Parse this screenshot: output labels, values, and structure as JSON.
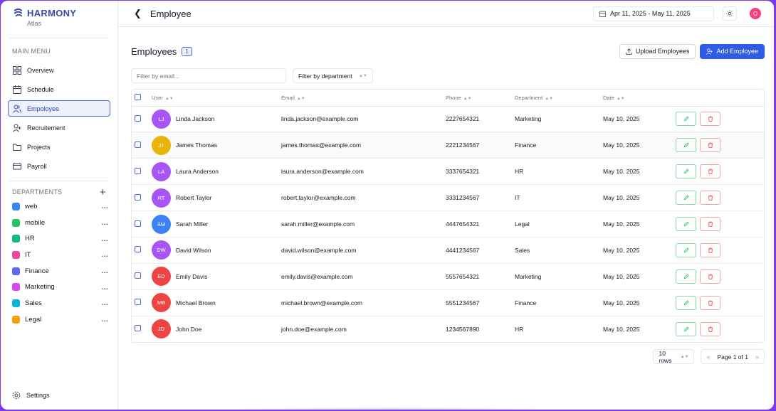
{
  "brand": {
    "name": "HARMONY",
    "sub": "Atlas"
  },
  "sidebar": {
    "main_menu_label": "MAIN MENU",
    "items": [
      {
        "label": "Overview",
        "icon": "grid-icon"
      },
      {
        "label": "Schedule",
        "icon": "calendar-icon"
      },
      {
        "label": "Empoloyee",
        "icon": "users-icon",
        "active": true
      },
      {
        "label": "Recruitement",
        "icon": "user-plus-icon"
      },
      {
        "label": "Projects",
        "icon": "folder-icon"
      },
      {
        "label": "Payroll",
        "icon": "card-icon"
      }
    ],
    "departments_label": "DEPARTMENTS",
    "departments": [
      {
        "name": "web",
        "color": "#3b82f6"
      },
      {
        "name": "mobile",
        "color": "#22c55e"
      },
      {
        "name": "HR",
        "color": "#10b981"
      },
      {
        "name": "IT",
        "color": "#ec4899"
      },
      {
        "name": "Finance",
        "color": "#6366f1"
      },
      {
        "name": "Marketing",
        "color": "#d946ef"
      },
      {
        "name": "Sales",
        "color": "#06b6d4"
      },
      {
        "name": "Legal",
        "color": "#f59e0b"
      }
    ],
    "more_label": "...",
    "settings_label": "Settings"
  },
  "topbar": {
    "title": "Employee",
    "date_range": "Apr 11, 2025 - May 11, 2025",
    "avatar_initial": "O"
  },
  "page": {
    "title": "Employees",
    "count": "1",
    "upload_label": "Upload Employees",
    "add_label": "Add Employee",
    "filter_email_placeholder": "Filter by email...",
    "filter_department_label": "Filter by department"
  },
  "table": {
    "columns": [
      "User",
      "Email",
      "Phone",
      "Department",
      "Date"
    ],
    "rows": [
      {
        "initials": "LJ",
        "color": "#a855f7",
        "name": "Linda Jackson",
        "email": "linda.jackson@example.com",
        "phone": "2227654321",
        "department": "Marketing",
        "date": "May 10, 2025"
      },
      {
        "initials": "JT",
        "color": "#eab308",
        "name": "James Thomas",
        "email": "james.thomas@example.com",
        "phone": "2221234567",
        "department": "Finance",
        "date": "May 10, 2025"
      },
      {
        "initials": "LA",
        "color": "#a855f7",
        "name": "Laura Anderson",
        "email": "laura.anderson@example.com",
        "phone": "3337654321",
        "department": "HR",
        "date": "May 10, 2025"
      },
      {
        "initials": "RT",
        "color": "#a855f7",
        "name": "Robert Taylor",
        "email": "robert.taylor@example.com",
        "phone": "3331234567",
        "department": "IT",
        "date": "May 10, 2025"
      },
      {
        "initials": "SM",
        "color": "#3b82f6",
        "name": "Sarah Miller",
        "email": "sarah.miller@example.com",
        "phone": "4447654321",
        "department": "Legal",
        "date": "May 10, 2025"
      },
      {
        "initials": "DW",
        "color": "#a855f7",
        "name": "David Wilson",
        "email": "david.wilson@example.com",
        "phone": "4441234567",
        "department": "Sales",
        "date": "May 10, 2025"
      },
      {
        "initials": "ED",
        "color": "#ef4444",
        "name": "Emily Davis",
        "email": "emily.davis@example.com",
        "phone": "5557654321",
        "department": "Marketing",
        "date": "May 10, 2025"
      },
      {
        "initials": "MB",
        "color": "#ef4444",
        "name": "Michael Brown",
        "email": "michael.brown@example.com",
        "phone": "5551234567",
        "department": "Finance",
        "date": "May 10, 2025"
      },
      {
        "initials": "JD",
        "color": "#ef4444",
        "name": "John Doe",
        "email": "john.doe@example.com",
        "phone": "1234567890",
        "department": "HR",
        "date": "May 10, 2025"
      }
    ]
  },
  "pagination": {
    "rows_label": "10 rows",
    "page_label": "Page 1 of 1"
  }
}
